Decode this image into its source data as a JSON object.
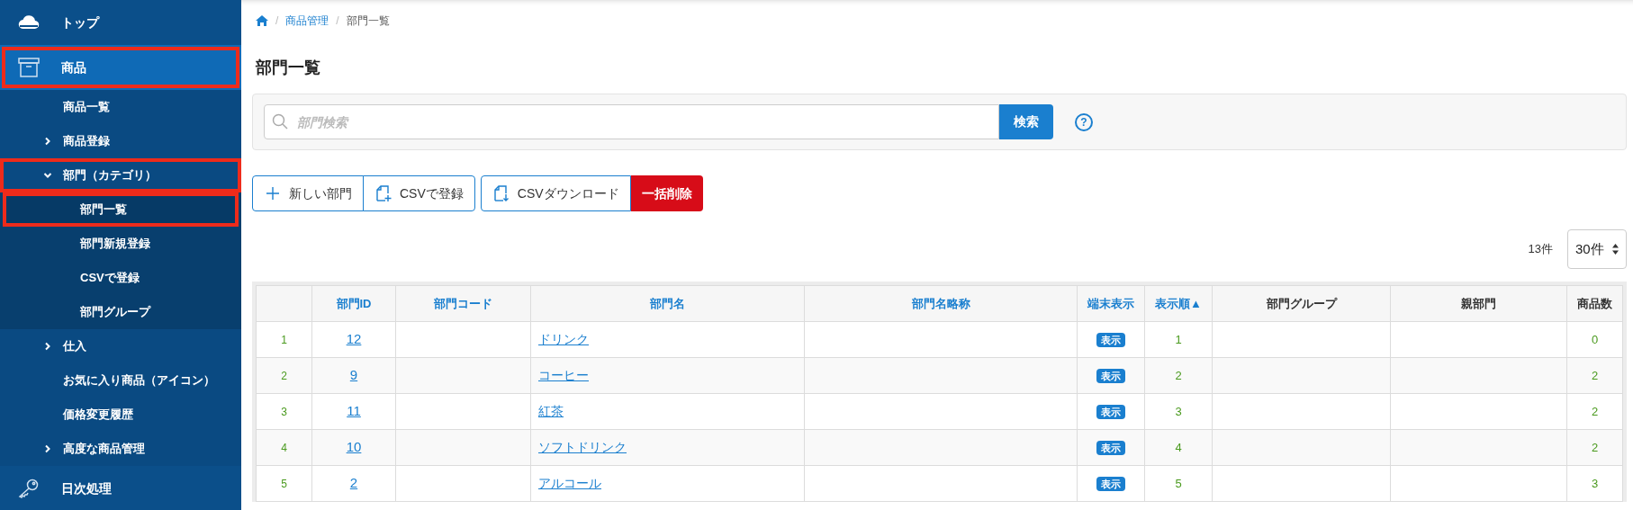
{
  "sidebar": {
    "sections": [
      {
        "label": "トップ",
        "selected": false,
        "highlighted": false
      },
      {
        "label": "商品",
        "selected": true,
        "highlighted": true,
        "children": [
          {
            "label": "商品一覧",
            "selected": false,
            "highlighted": false
          },
          {
            "label": "商品登録",
            "expanded": false,
            "selected": false,
            "highlighted": false
          },
          {
            "label": "部門（カテゴリ）",
            "expanded": true,
            "selected": false,
            "highlighted": true,
            "children": [
              {
                "label": "部門一覧",
                "selected": true,
                "highlighted": true
              },
              {
                "label": "部門新規登録",
                "selected": false,
                "highlighted": false
              },
              {
                "label": "CSVで登録",
                "selected": false,
                "highlighted": false
              },
              {
                "label": "部門グループ",
                "selected": false,
                "highlighted": false
              }
            ]
          },
          {
            "label": "仕入",
            "expanded": false,
            "selected": false,
            "highlighted": false
          },
          {
            "label": "お気に入り商品（アイコン）",
            "selected": false,
            "highlighted": false
          },
          {
            "label": "価格変更履歴",
            "selected": false,
            "highlighted": false
          },
          {
            "label": "高度な商品管理",
            "expanded": false,
            "selected": false,
            "highlighted": false
          }
        ]
      },
      {
        "label": "日次処理",
        "selected": false,
        "highlighted": false
      }
    ]
  },
  "breadcrumb": [
    {
      "separator": "/",
      "label": "商品管理",
      "link": true
    },
    {
      "separator": "/",
      "label": "部門一覧",
      "link": false
    }
  ],
  "title": "部門一覧",
  "search": {
    "placeholder": "部門検索",
    "button": "検索",
    "help": "?"
  },
  "actions": [
    [
      {
        "label": "新しい部門",
        "kind": "add"
      },
      {
        "label": "CSVで登録",
        "kind": "upload"
      }
    ],
    [
      {
        "label": "CSVダウンロード",
        "kind": "download"
      },
      {
        "label": "一括削除",
        "kind": "danger"
      }
    ]
  ],
  "count": "13件",
  "page_size": "30件",
  "table": {
    "columns": [
      {
        "label": "部門ID",
        "sortable": true
      },
      {
        "label": "部門コード",
        "sortable": true
      },
      {
        "label": "部門名",
        "sortable": true
      },
      {
        "label": "部門名略称",
        "sortable": true
      },
      {
        "label": "端末表示",
        "sortable": true
      },
      {
        "label": "表示順▲",
        "sortable": true
      },
      {
        "label": "部門グループ",
        "sortable": false
      },
      {
        "label": "親部門",
        "sortable": false
      },
      {
        "label": "商品数",
        "sortable": false
      }
    ],
    "rows": [
      {
        "no": "1",
        "id": "12",
        "code": "",
        "name": "ドリンク",
        "short": "",
        "display": "表示",
        "order": "1",
        "group": "",
        "parent": "",
        "items": "0"
      },
      {
        "no": "2",
        "id": "9",
        "code": "",
        "name": "コーヒー",
        "short": "",
        "display": "表示",
        "order": "2",
        "group": "",
        "parent": "",
        "items": "2"
      },
      {
        "no": "3",
        "id": "11",
        "code": "",
        "name": "紅茶",
        "short": "",
        "display": "表示",
        "order": "3",
        "group": "",
        "parent": "",
        "items": "2"
      },
      {
        "no": "4",
        "id": "10",
        "code": "",
        "name": "ソフトドリンク",
        "short": "",
        "display": "表示",
        "order": "4",
        "group": "",
        "parent": "",
        "items": "2"
      },
      {
        "no": "5",
        "id": "2",
        "code": "",
        "name": "アルコール",
        "short": "",
        "display": "表示",
        "order": "5",
        "group": "",
        "parent": "",
        "items": "3"
      }
    ]
  }
}
